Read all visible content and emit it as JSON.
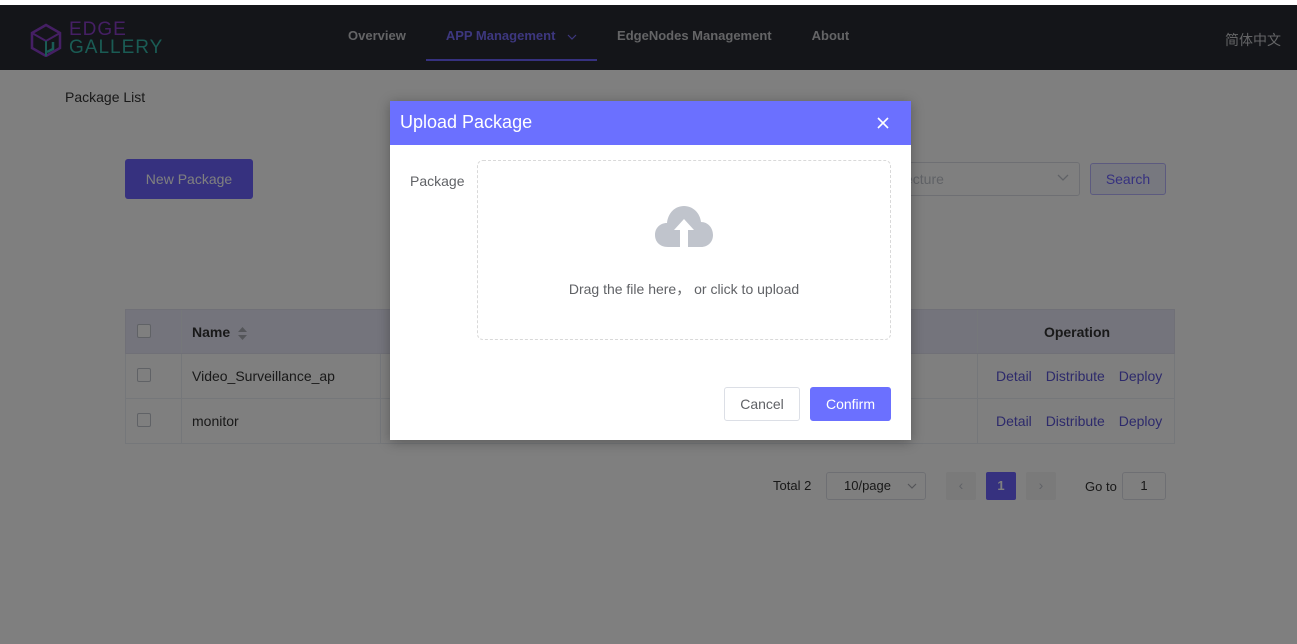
{
  "header": {
    "logo_line1": "EDGE",
    "logo_line2": "GALLERY",
    "nav": [
      {
        "label": "Overview"
      },
      {
        "label": "APP Management"
      },
      {
        "label": "EdgeNodes Management"
      },
      {
        "label": "About"
      }
    ],
    "language": "简体中文"
  },
  "page": {
    "breadcrumb": "Package List",
    "new_package_label": "New Package",
    "architecture_placeholder": "ecture",
    "search_label": "Search"
  },
  "table": {
    "columns": {
      "name": "Name",
      "operation": "Operation"
    },
    "rows": [
      {
        "name": "Video_Surveillance_ap",
        "detail": "Detail",
        "distribute": "Distribute",
        "deploy": "Deploy"
      },
      {
        "name": "monitor",
        "detail": "Detail",
        "distribute": "Distribute",
        "deploy": "Deploy"
      }
    ]
  },
  "pagination": {
    "total": "Total 2",
    "page_size": "10/page",
    "prev": "‹",
    "current_page": "1",
    "next": "›",
    "goto_label": "Go to",
    "goto_value": "1"
  },
  "dialog": {
    "title": "Upload Package",
    "field_label": "Package",
    "upload_hint": "Drag the file here， or click to upload",
    "cancel_label": "Cancel",
    "confirm_label": "Confirm"
  },
  "colors": {
    "primary": "#6b70ff",
    "header_bg": "#282b33",
    "link": "#5a55d6"
  }
}
